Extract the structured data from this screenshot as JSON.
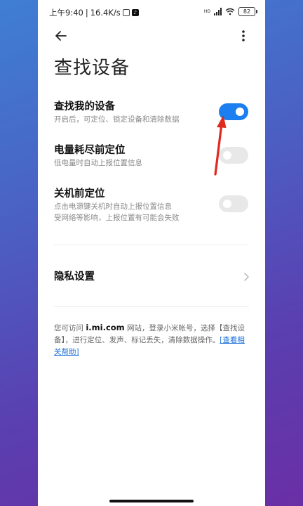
{
  "status_bar": {
    "time": "上午9:40",
    "separator": "|",
    "net_speed": "16.4K/s",
    "battery": "82",
    "signal_label": "HD"
  },
  "header": {
    "title": "查找设备"
  },
  "settings": [
    {
      "title": "查找我的设备",
      "subtitle": "开启后，可定位、锁定设备和清除数据",
      "enabled": true
    },
    {
      "title": "电量耗尽前定位",
      "subtitle": "低电量时自动上报位置信息",
      "enabled": false
    },
    {
      "title": "关机前定位",
      "subtitle": "点击电源键关机时自动上报位置信息",
      "subtitle2": "受网络等影响，上报位置有可能会失败",
      "enabled": false
    }
  ],
  "privacy": {
    "label": "隐私设置"
  },
  "help": {
    "prefix": "您可访问 ",
    "url": "i.mi.com",
    "middle": " 网站，登录小米帐号，选择【查找设备】，进行定位、发声、标记丢失，清除数据操作。",
    "link": "[查看相关帮助]"
  },
  "colors": {
    "accent": "#1b7ff0",
    "annotation_arrow": "#e0291f"
  }
}
